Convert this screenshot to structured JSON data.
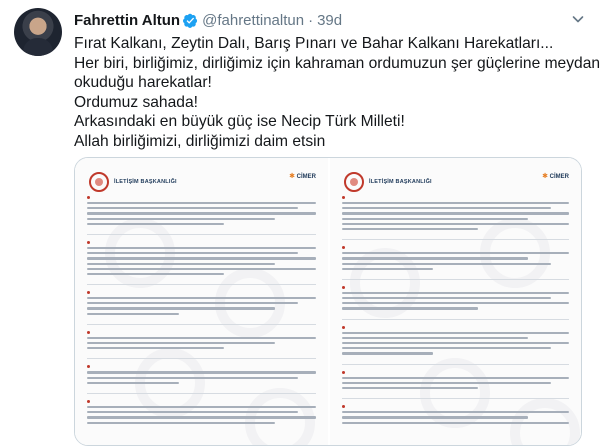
{
  "author": {
    "display_name": "Fahrettin Altun",
    "handle": "@fahrettinaltun",
    "separator": "·",
    "time": "39d"
  },
  "icons": {
    "verified": "verified-badge-icon",
    "more": "chevron-down-icon"
  },
  "colors": {
    "verified": "#1da1f2",
    "text": "#14171a",
    "muted": "#657786",
    "accent_red": "#c0392b"
  },
  "tweet": {
    "lines": [
      "Fırat Kalkanı, Zeytin Dalı, Barış Pınarı ve Bahar Kalkanı Harekatları...",
      "Her biri, birliğimiz, dirliğimiz için kahraman ordumuzun şer güçlerine meydan",
      "okuduğu harekatlar!",
      "Ordumuz sahada!",
      "Arkasındaki en büyük güç ise Necip Türk Milleti!",
      "Allah birliğimizi, dirliğimizi daim etsin"
    ]
  },
  "media": {
    "documents": [
      {
        "logo": "İLETİŞİM BAŞKANLIĞI",
        "badge": "CİMER"
      },
      {
        "logo": "İLETİŞİM BAŞKANLIĞI",
        "badge": "CİMER"
      }
    ]
  }
}
